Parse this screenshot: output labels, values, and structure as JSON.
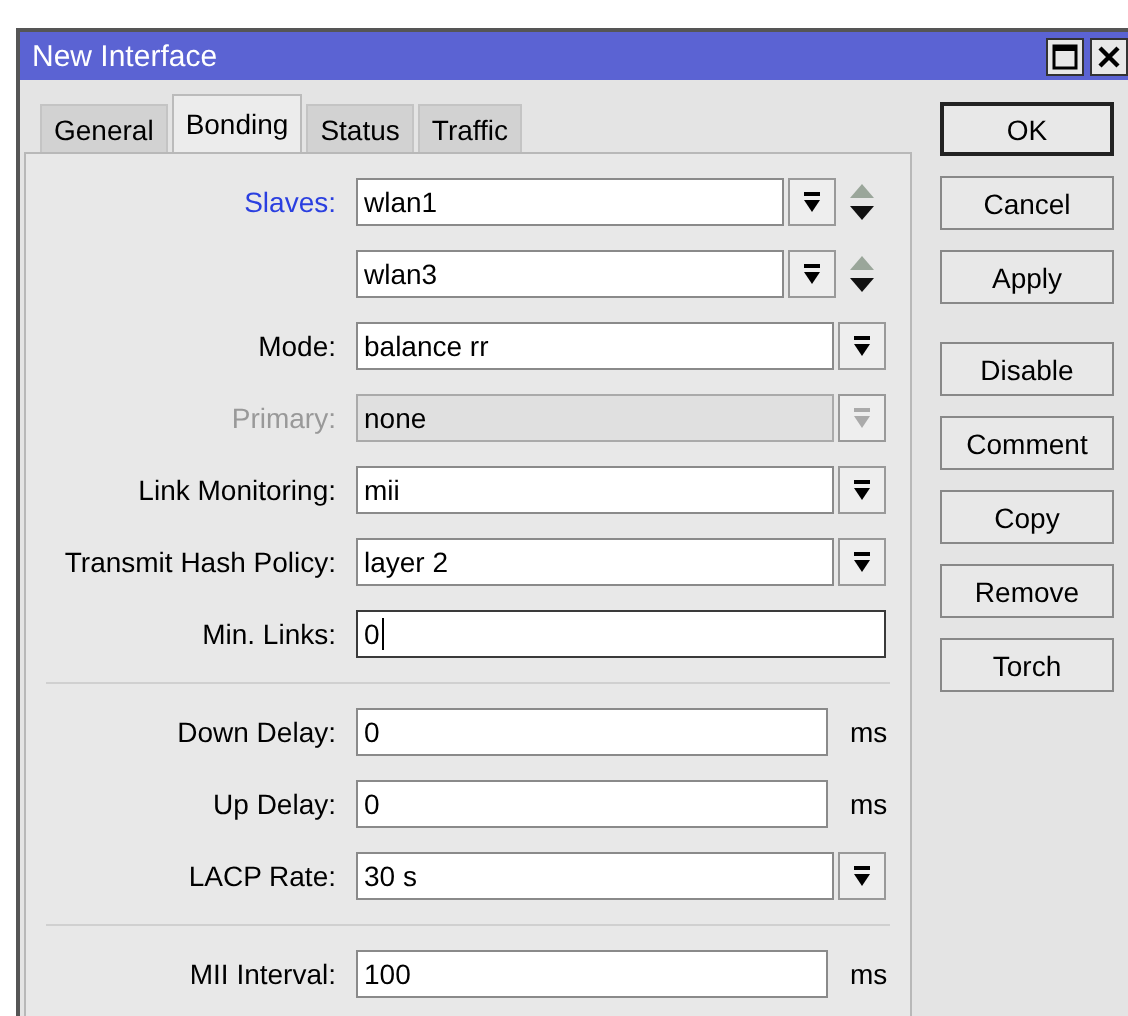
{
  "window": {
    "title": "New Interface"
  },
  "tabs": [
    {
      "label": "General",
      "selected": false
    },
    {
      "label": "Bonding",
      "selected": true
    },
    {
      "label": "Status",
      "selected": false
    },
    {
      "label": "Traffic",
      "selected": false
    }
  ],
  "rows": [
    {
      "kind": "multi-select",
      "label": "Slaves:",
      "label_link": true,
      "disabled": false,
      "value": "wlan1"
    },
    {
      "kind": "multi-select",
      "disabled": false,
      "value": "wlan3"
    },
    {
      "kind": "select",
      "label": "Mode:",
      "label_link": false,
      "disabled": false,
      "value": "balance rr"
    },
    {
      "kind": "select",
      "label": "Primary:",
      "label_link": false,
      "disabled": true,
      "value": "none"
    },
    {
      "kind": "select",
      "label": "Link Monitoring:",
      "label_link": false,
      "disabled": false,
      "value": "mii"
    },
    {
      "kind": "select",
      "label": "Transmit Hash Policy:",
      "label_link": false,
      "disabled": false,
      "value": "layer 2"
    },
    {
      "kind": "text",
      "label": "Min. Links:",
      "label_link": false,
      "disabled": false,
      "focused": true,
      "value": "0"
    },
    {
      "kind": "separator"
    },
    {
      "kind": "unit",
      "label": "Down Delay:",
      "label_link": false,
      "disabled": false,
      "focused": false,
      "value": "0",
      "unit": "ms"
    },
    {
      "kind": "unit",
      "label": "Up Delay:",
      "label_link": false,
      "disabled": false,
      "focused": false,
      "value": "0",
      "unit": "ms"
    },
    {
      "kind": "select",
      "label": "LACP Rate:",
      "label_link": false,
      "disabled": false,
      "value": "30 s"
    },
    {
      "kind": "separator"
    },
    {
      "kind": "unit",
      "label": "MII Interval:",
      "label_link": false,
      "disabled": false,
      "focused": false,
      "value": "100",
      "unit": "ms"
    }
  ],
  "button_groups": [
    [
      {
        "label": "OK",
        "default": true
      },
      {
        "label": "Cancel",
        "default": false
      },
      {
        "label": "Apply",
        "default": false
      }
    ],
    [
      {
        "label": "Disable",
        "default": false
      },
      {
        "label": "Comment",
        "default": false
      },
      {
        "label": "Copy",
        "default": false
      },
      {
        "label": "Remove",
        "default": false
      },
      {
        "label": "Torch",
        "default": false
      }
    ]
  ]
}
